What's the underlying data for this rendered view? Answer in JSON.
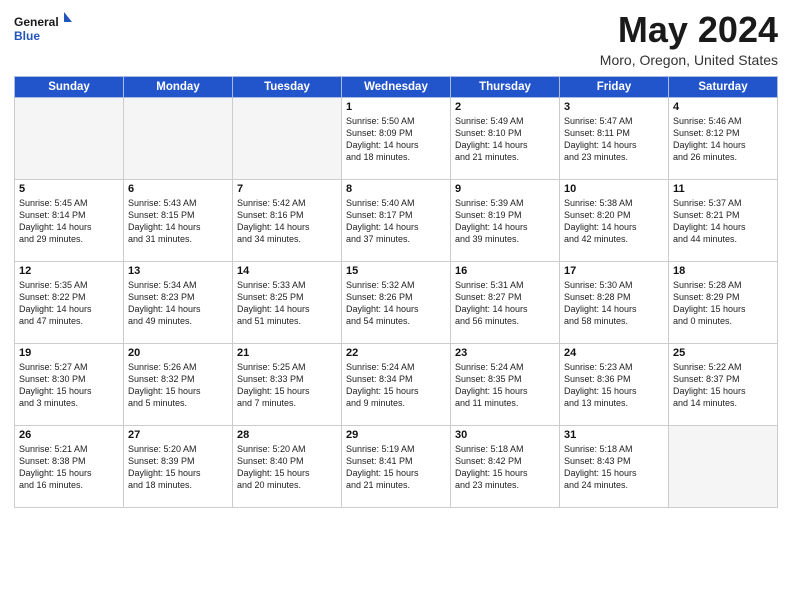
{
  "logo": {
    "line1": "General",
    "line2": "Blue"
  },
  "title": "May 2024",
  "location": "Moro, Oregon, United States",
  "days_of_week": [
    "Sunday",
    "Monday",
    "Tuesday",
    "Wednesday",
    "Thursday",
    "Friday",
    "Saturday"
  ],
  "weeks": [
    [
      {
        "day": "",
        "text": ""
      },
      {
        "day": "",
        "text": ""
      },
      {
        "day": "",
        "text": ""
      },
      {
        "day": "1",
        "text": "Sunrise: 5:50 AM\nSunset: 8:09 PM\nDaylight: 14 hours\nand 18 minutes."
      },
      {
        "day": "2",
        "text": "Sunrise: 5:49 AM\nSunset: 8:10 PM\nDaylight: 14 hours\nand 21 minutes."
      },
      {
        "day": "3",
        "text": "Sunrise: 5:47 AM\nSunset: 8:11 PM\nDaylight: 14 hours\nand 23 minutes."
      },
      {
        "day": "4",
        "text": "Sunrise: 5:46 AM\nSunset: 8:12 PM\nDaylight: 14 hours\nand 26 minutes."
      }
    ],
    [
      {
        "day": "5",
        "text": "Sunrise: 5:45 AM\nSunset: 8:14 PM\nDaylight: 14 hours\nand 29 minutes."
      },
      {
        "day": "6",
        "text": "Sunrise: 5:43 AM\nSunset: 8:15 PM\nDaylight: 14 hours\nand 31 minutes."
      },
      {
        "day": "7",
        "text": "Sunrise: 5:42 AM\nSunset: 8:16 PM\nDaylight: 14 hours\nand 34 minutes."
      },
      {
        "day": "8",
        "text": "Sunrise: 5:40 AM\nSunset: 8:17 PM\nDaylight: 14 hours\nand 37 minutes."
      },
      {
        "day": "9",
        "text": "Sunrise: 5:39 AM\nSunset: 8:19 PM\nDaylight: 14 hours\nand 39 minutes."
      },
      {
        "day": "10",
        "text": "Sunrise: 5:38 AM\nSunset: 8:20 PM\nDaylight: 14 hours\nand 42 minutes."
      },
      {
        "day": "11",
        "text": "Sunrise: 5:37 AM\nSunset: 8:21 PM\nDaylight: 14 hours\nand 44 minutes."
      }
    ],
    [
      {
        "day": "12",
        "text": "Sunrise: 5:35 AM\nSunset: 8:22 PM\nDaylight: 14 hours\nand 47 minutes."
      },
      {
        "day": "13",
        "text": "Sunrise: 5:34 AM\nSunset: 8:23 PM\nDaylight: 14 hours\nand 49 minutes."
      },
      {
        "day": "14",
        "text": "Sunrise: 5:33 AM\nSunset: 8:25 PM\nDaylight: 14 hours\nand 51 minutes."
      },
      {
        "day": "15",
        "text": "Sunrise: 5:32 AM\nSunset: 8:26 PM\nDaylight: 14 hours\nand 54 minutes."
      },
      {
        "day": "16",
        "text": "Sunrise: 5:31 AM\nSunset: 8:27 PM\nDaylight: 14 hours\nand 56 minutes."
      },
      {
        "day": "17",
        "text": "Sunrise: 5:30 AM\nSunset: 8:28 PM\nDaylight: 14 hours\nand 58 minutes."
      },
      {
        "day": "18",
        "text": "Sunrise: 5:28 AM\nSunset: 8:29 PM\nDaylight: 15 hours\nand 0 minutes."
      }
    ],
    [
      {
        "day": "19",
        "text": "Sunrise: 5:27 AM\nSunset: 8:30 PM\nDaylight: 15 hours\nand 3 minutes."
      },
      {
        "day": "20",
        "text": "Sunrise: 5:26 AM\nSunset: 8:32 PM\nDaylight: 15 hours\nand 5 minutes."
      },
      {
        "day": "21",
        "text": "Sunrise: 5:25 AM\nSunset: 8:33 PM\nDaylight: 15 hours\nand 7 minutes."
      },
      {
        "day": "22",
        "text": "Sunrise: 5:24 AM\nSunset: 8:34 PM\nDaylight: 15 hours\nand 9 minutes."
      },
      {
        "day": "23",
        "text": "Sunrise: 5:24 AM\nSunset: 8:35 PM\nDaylight: 15 hours\nand 11 minutes."
      },
      {
        "day": "24",
        "text": "Sunrise: 5:23 AM\nSunset: 8:36 PM\nDaylight: 15 hours\nand 13 minutes."
      },
      {
        "day": "25",
        "text": "Sunrise: 5:22 AM\nSunset: 8:37 PM\nDaylight: 15 hours\nand 14 minutes."
      }
    ],
    [
      {
        "day": "26",
        "text": "Sunrise: 5:21 AM\nSunset: 8:38 PM\nDaylight: 15 hours\nand 16 minutes."
      },
      {
        "day": "27",
        "text": "Sunrise: 5:20 AM\nSunset: 8:39 PM\nDaylight: 15 hours\nand 18 minutes."
      },
      {
        "day": "28",
        "text": "Sunrise: 5:20 AM\nSunset: 8:40 PM\nDaylight: 15 hours\nand 20 minutes."
      },
      {
        "day": "29",
        "text": "Sunrise: 5:19 AM\nSunset: 8:41 PM\nDaylight: 15 hours\nand 21 minutes."
      },
      {
        "day": "30",
        "text": "Sunrise: 5:18 AM\nSunset: 8:42 PM\nDaylight: 15 hours\nand 23 minutes."
      },
      {
        "day": "31",
        "text": "Sunrise: 5:18 AM\nSunset: 8:43 PM\nDaylight: 15 hours\nand 24 minutes."
      },
      {
        "day": "",
        "text": ""
      }
    ]
  ]
}
